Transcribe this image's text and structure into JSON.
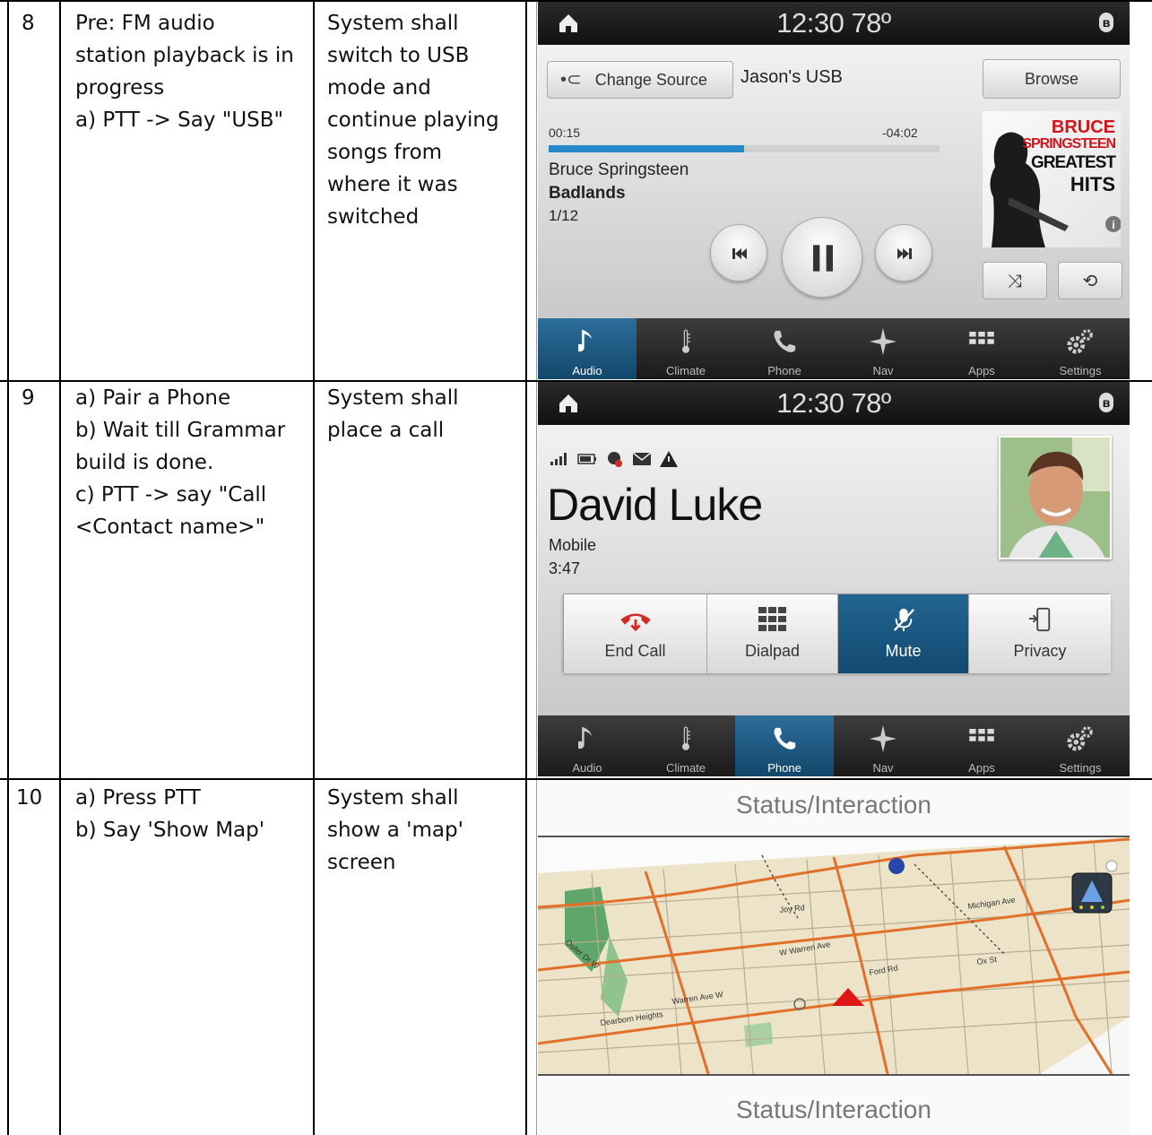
{
  "rows": [
    {
      "number": "8",
      "precondition": "Pre: FM audio\nstation playback is in\nprogress\na) PTT -> Say \"USB\"",
      "expected": "System shall\nswitch to USB\nmode and\ncontinue playing\nsongs from\nwhere it was\nswitched"
    },
    {
      "number": "9",
      "precondition": "a) Pair a Phone\nb) Wait till Grammar\nbuild is done.\nc) PTT -> say \"Call\n<Contact name>\"",
      "expected": "System shall\nplace a call"
    },
    {
      "number": "10",
      "precondition": "a) Press PTT\nb) Say 'Show Map'",
      "expected": "System shall\nshow a 'map'\nscreen"
    }
  ],
  "audio_screen": {
    "clock": "12:30  78º",
    "change_source": "Change Source",
    "source_name": "Jason's USB",
    "browse": "Browse",
    "elapsed": "00:15",
    "remaining": "-04:02",
    "progress": 0.5,
    "artist": "Bruce Springsteen",
    "track": "Badlands",
    "track_count": "1/12",
    "album_art": {
      "line1": "BRUCE",
      "line2": "SPRINGSTEEN",
      "line3": "GREATEST",
      "line4": "HITS"
    }
  },
  "phone_screen": {
    "clock": "12:30  78º",
    "contact": "David Luke",
    "number_type": "Mobile",
    "duration": "3:47",
    "buttons": [
      "End Call",
      "Dialpad",
      "Mute",
      "Privacy"
    ],
    "active_button": "Mute"
  },
  "nav_items": [
    "Audio",
    "Climate",
    "Phone",
    "Nav",
    "Apps",
    "Settings"
  ],
  "map_screen": {
    "top_label": "Status/Interaction",
    "bottom_label": "Status/Interaction"
  },
  "colors": {
    "active_blue": "#1d5f8a",
    "progress_blue": "#2589c8",
    "end_call_red": "#d02a22",
    "map_land": "#ece3c8",
    "map_road": "#e0702a",
    "map_park": "#5fa66a",
    "vehicle_red": "#e01515"
  }
}
